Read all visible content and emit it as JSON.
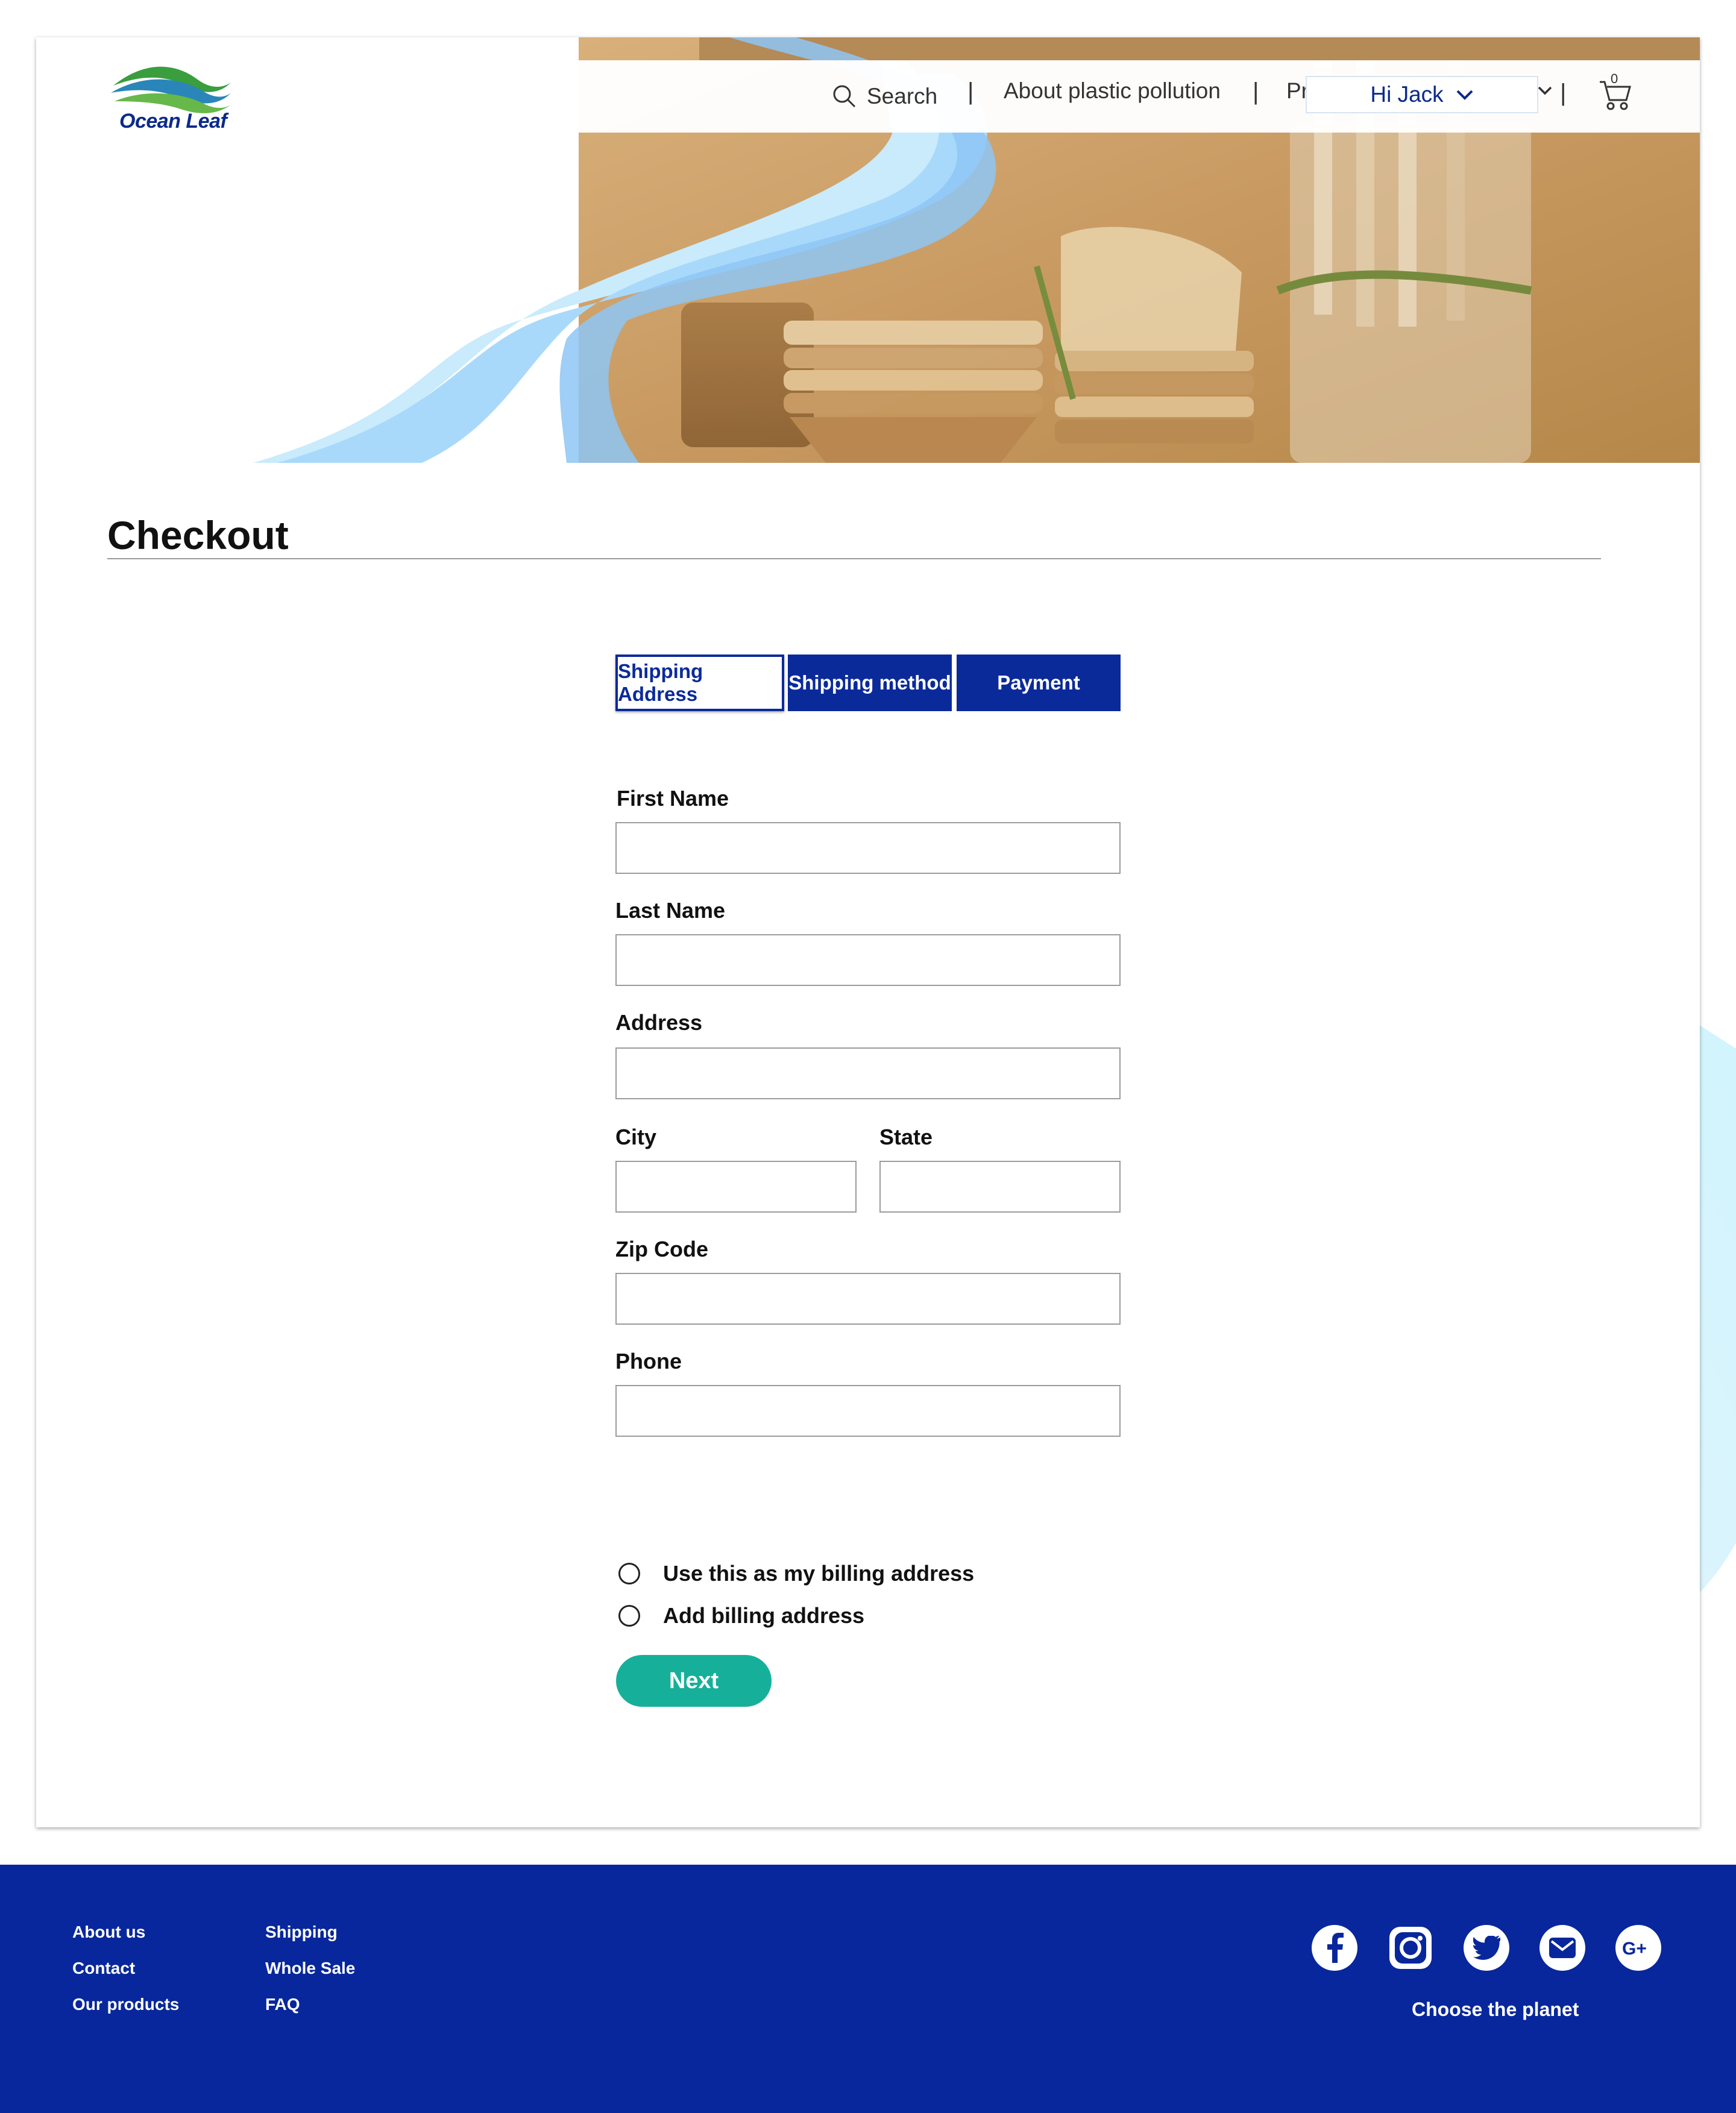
{
  "brand": {
    "name": "Ocean Leaf"
  },
  "header": {
    "search_label": "Search",
    "separator": "|",
    "nav_about": "About plastic pollution",
    "nav_products_truncated": "Pr",
    "user_greeting": "Hi Jack",
    "cart_count": "0"
  },
  "page": {
    "title": "Checkout"
  },
  "tabs": [
    {
      "label": "Shipping Address",
      "active": true
    },
    {
      "label": "Shipping method",
      "active": false
    },
    {
      "label": "Payment",
      "active": false
    }
  ],
  "form": {
    "first_name": {
      "label": "First Name",
      "value": ""
    },
    "last_name": {
      "label": "Last Name",
      "value": ""
    },
    "address": {
      "label": "Address",
      "value": ""
    },
    "city": {
      "label": "City",
      "value": ""
    },
    "state": {
      "label": "State",
      "value": ""
    },
    "zip": {
      "label": "Zip Code",
      "value": ""
    },
    "phone": {
      "label": "Phone",
      "value": ""
    }
  },
  "billing_options": [
    {
      "label": "Use this as my billing address",
      "selected": false
    },
    {
      "label": "Add billing address",
      "selected": false
    }
  ],
  "next_button": {
    "label": "Next"
  },
  "footer": {
    "col1": [
      "About us",
      "Contact",
      "Our products"
    ],
    "col2": [
      "Shipping",
      "Whole Sale",
      "FAQ"
    ],
    "social_icons": [
      "facebook-icon",
      "instagram-icon",
      "twitter-icon",
      "email-icon",
      "google-plus-icon"
    ],
    "tagline": "Choose the planet"
  },
  "colors": {
    "brand_blue": "#0b2a9a",
    "footer_blue": "#08279c",
    "accent_teal": "#16b09a",
    "wave_light": "#bfe6fb"
  }
}
